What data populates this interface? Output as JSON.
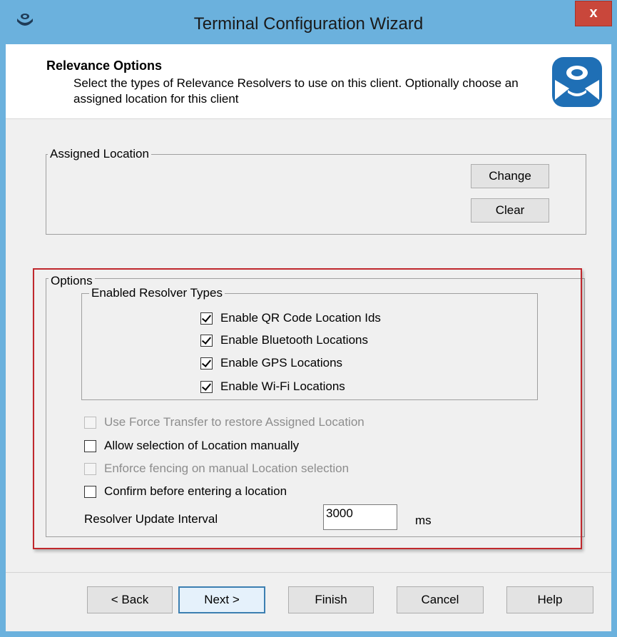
{
  "window": {
    "title": "Terminal Configuration Wizard",
    "close_label": "x",
    "title_bar_color": "#6bb1dd"
  },
  "header": {
    "title": "Relevance Options",
    "description": "Select the types of Relevance Resolvers to use on this client. Optionally choose an assigned location for this client",
    "logo_icon": "user-logo-icon"
  },
  "assigned_location": {
    "legend": "Assigned Location",
    "change_label": "Change",
    "clear_label": "Clear"
  },
  "options": {
    "legend": "Options",
    "resolver_types": {
      "legend": "Enabled Resolver Types",
      "items": [
        {
          "label": "Enable QR Code Location Ids",
          "checked": true
        },
        {
          "label": "Enable Bluetooth Locations",
          "checked": true
        },
        {
          "label": "Enable GPS Locations",
          "checked": true
        },
        {
          "label": "Enable Wi-Fi Locations",
          "checked": true
        }
      ]
    },
    "force_transfer": {
      "label": "Use Force Transfer to restore Assigned Location",
      "checked": false,
      "disabled": true
    },
    "manual_selection": {
      "label": "Allow selection of Location manually",
      "checked": false,
      "disabled": false
    },
    "enforce_fencing": {
      "label": "Enforce fencing on manual Location selection",
      "checked": false,
      "disabled": true
    },
    "confirm_before": {
      "label": "Confirm before entering a location",
      "checked": false,
      "disabled": false
    },
    "interval": {
      "label": "Resolver Update Interval",
      "value": "3000",
      "unit": "ms"
    }
  },
  "footer": {
    "back_label": "< Back",
    "next_label": "Next >",
    "finish_label": "Finish",
    "cancel_label": "Cancel",
    "help_label": "Help"
  },
  "colors": {
    "highlight_border": "#c0282d",
    "logo_blue": "#1f6fb5"
  }
}
